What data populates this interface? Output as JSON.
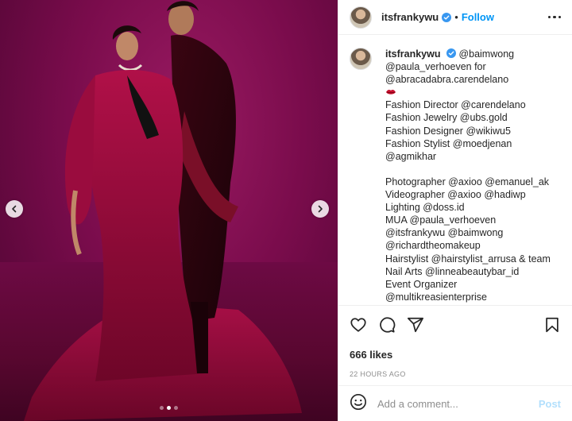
{
  "post": {
    "username": "itsfrankywu",
    "follow_label": "Follow",
    "separator": "•",
    "media": {
      "current_slide": 2,
      "total_slides": 3
    }
  },
  "caption": {
    "username": "itsfrankywu",
    "first_line": "@baimwong",
    "lines": [
      "@paula_verhoeven for",
      "@abracadabra.carendelano",
      "",
      "Fashion Director @carendelano",
      "Fashion Jewelry @ubs.gold",
      "Fashion Designer @wikiwu5",
      "Fashion Stylist @moedjenan",
      "@agmikhar",
      "",
      "Photographer @axioo @emanuel_ak",
      "Videographer @axioo @hadiwp",
      "Lighting @doss.id",
      "MUA @paula_verhoeven",
      "@itsfrankywu @baimwong",
      "@richardtheomakeup",
      "Hairstylist @hairstylist_arrusa & team",
      "Nail Arts @linneabeautybar_id",
      "Event Organizer",
      "@multikreasienterprise"
    ]
  },
  "engagement": {
    "likes": "666 likes",
    "timestamp": "22 HOURS AGO"
  },
  "comment": {
    "placeholder": "Add a comment...",
    "post_label": "Post"
  },
  "colors": {
    "link_blue": "#0095f6",
    "post_disabled": "#b2dffc",
    "backdrop_magenta": "#7a0c4c",
    "lips_red": "#c8102e"
  },
  "icons": [
    "verified-badge-icon",
    "more-options-icon",
    "chevron-left-icon",
    "chevron-right-icon",
    "heart-icon",
    "comment-icon",
    "share-icon",
    "bookmark-icon",
    "emoji-icon",
    "lips-emoji-icon"
  ]
}
